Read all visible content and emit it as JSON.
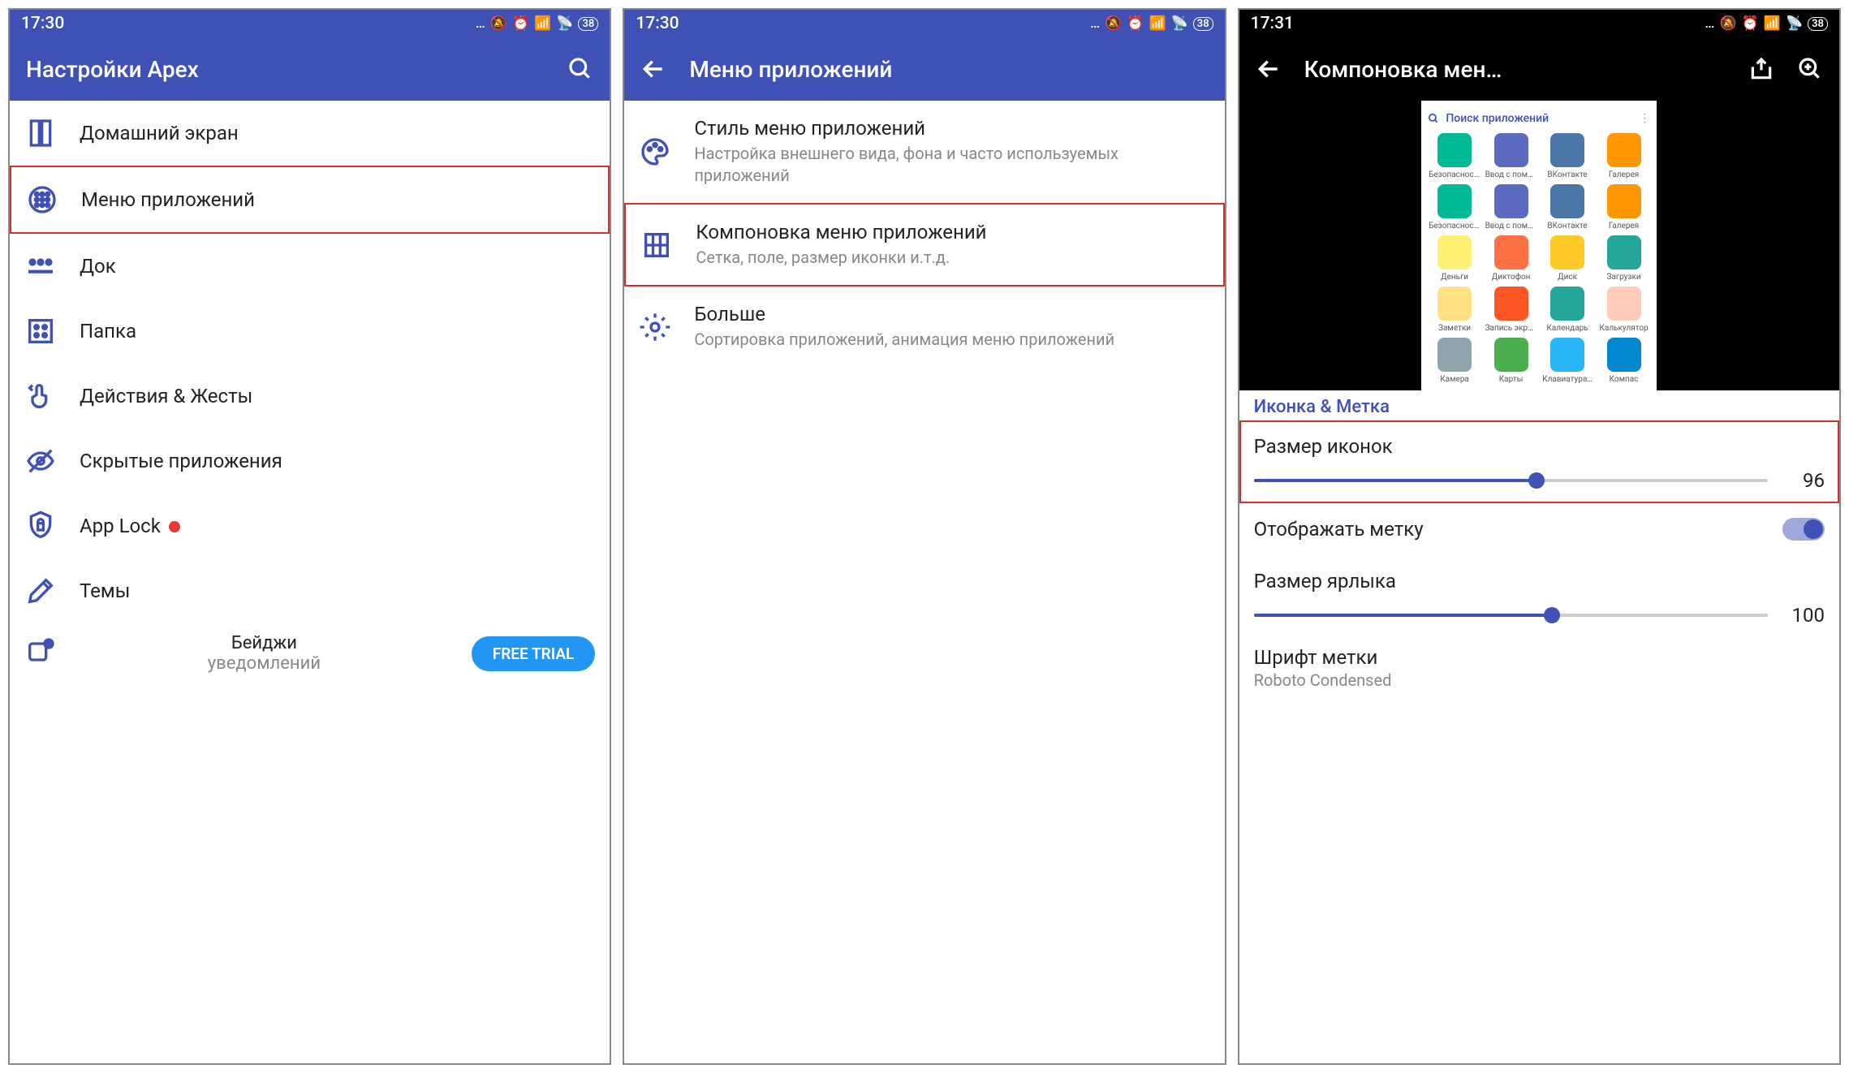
{
  "status": {
    "time1": "17:30",
    "time2": "17:30",
    "time3": "17:31",
    "battery": "38"
  },
  "s1": {
    "title": "Настройки Apex",
    "items": [
      {
        "label": "Домашний экран"
      },
      {
        "label": "Меню приложений"
      },
      {
        "label": "Док"
      },
      {
        "label": "Папка"
      },
      {
        "label": "Действия & Жесты"
      },
      {
        "label": "Скрытые приложения"
      },
      {
        "label": "App Lock"
      },
      {
        "label": "Темы"
      }
    ],
    "badge_label": "Бейджи",
    "badge_sub": "уведомлений",
    "trial": "FREE TRIAL"
  },
  "s2": {
    "title": "Меню приложений",
    "items": [
      {
        "title": "Стиль меню приложений",
        "sub": "Настройка внешнего вида, фона и часто используемых приложений"
      },
      {
        "title": "Компоновка меню приложений",
        "sub": "Сетка, поле, размер иконки и.т.д."
      },
      {
        "title": "Больше",
        "sub": "Сортировка приложений, анимация меню приложений"
      }
    ]
  },
  "s3": {
    "title": "Компоновка мен…",
    "search_placeholder": "Поиск приложений",
    "apps": [
      {
        "label": "Безопасность",
        "color": "#00b894"
      },
      {
        "label": "Ввод с помо…",
        "color": "#5c6bc0"
      },
      {
        "label": "ВКонтакте",
        "color": "#4a76a8"
      },
      {
        "label": "Галерея",
        "color": "#ff9800"
      },
      {
        "label": "Безопасность",
        "color": "#00b894"
      },
      {
        "label": "Ввод с помо…",
        "color": "#5c6bc0"
      },
      {
        "label": "ВКонтакте",
        "color": "#4a76a8"
      },
      {
        "label": "Галерея",
        "color": "#ff9800"
      },
      {
        "label": "Деньги",
        "color": "#fff176"
      },
      {
        "label": "Диктофон",
        "color": "#ff7043"
      },
      {
        "label": "Диск",
        "color": "#ffca28"
      },
      {
        "label": "Загрузки",
        "color": "#26a69a"
      },
      {
        "label": "Заметки",
        "color": "#ffe082"
      },
      {
        "label": "Запись экрана",
        "color": "#ff5722"
      },
      {
        "label": "Календарь",
        "color": "#26a69a"
      },
      {
        "label": "Калькулятор",
        "color": "#ffccbc"
      },
      {
        "label": "Камера",
        "color": "#90a4ae"
      },
      {
        "label": "Карты",
        "color": "#4caf50"
      },
      {
        "label": "Клавиатура…",
        "color": "#29b6f6"
      },
      {
        "label": "Компас",
        "color": "#0288d1"
      }
    ],
    "section_header": "Иконка & Метка",
    "icon_size_label": "Размер иконок",
    "icon_size_value": "96",
    "icon_size_percent": 55,
    "show_label": "Отображать метку",
    "label_size_label": "Размер ярлыка",
    "label_size_value": "100",
    "label_size_percent": 58,
    "font_label": "Шрифт метки",
    "font_value": "Roboto Condensed"
  }
}
